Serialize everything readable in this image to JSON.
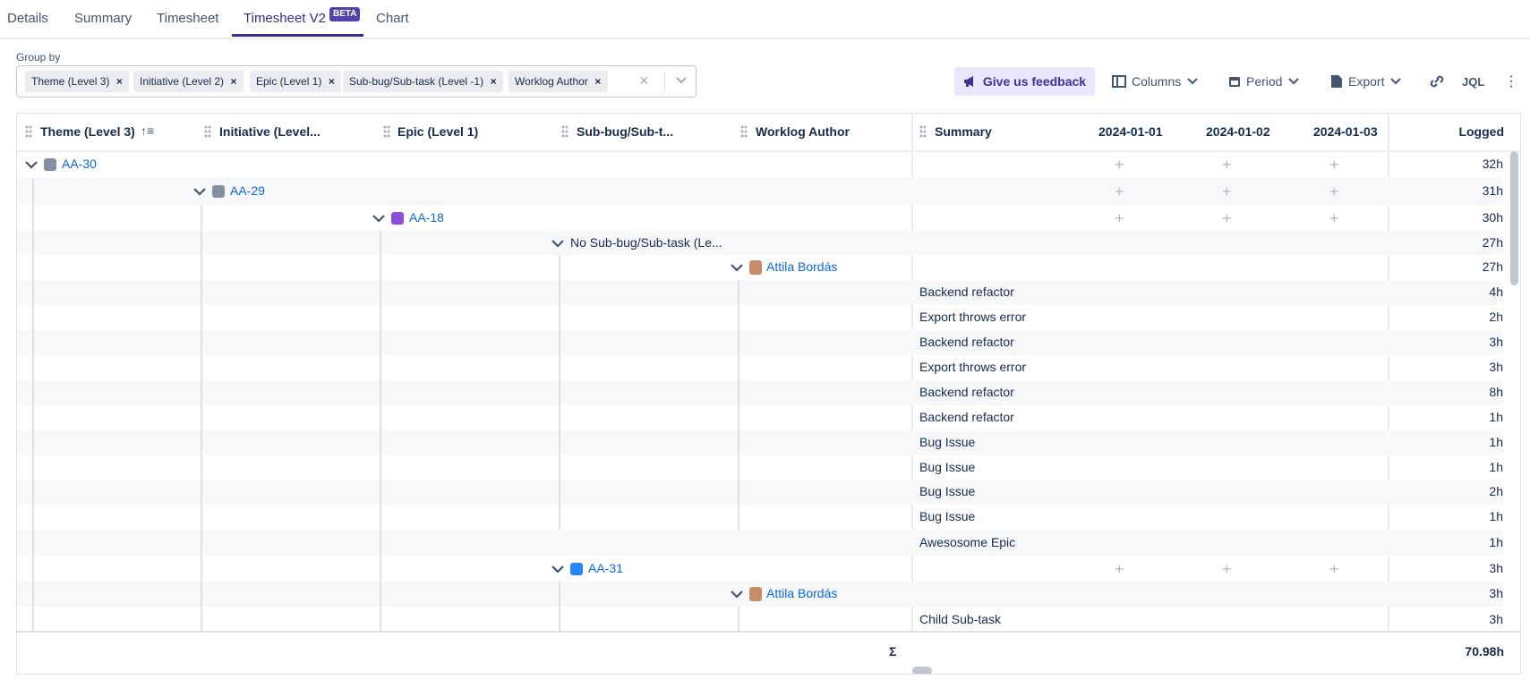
{
  "tabs": [
    {
      "label": "Details"
    },
    {
      "label": "Summary"
    },
    {
      "label": "Timesheet"
    },
    {
      "label": "Timesheet V2",
      "badge": "BETA"
    },
    {
      "label": "Chart"
    }
  ],
  "group_by": {
    "label": "Group by",
    "chips": [
      "Theme (Level 3)",
      "Initiative (Level 2)",
      "Epic (Level 1)",
      "Sub-bug/Sub-task (Level -1)",
      "Worklog Author"
    ]
  },
  "toolbar": {
    "feedback": "Give us feedback",
    "columns": "Columns",
    "period": "Period",
    "export": "Export",
    "jql": "JQL"
  },
  "columns": {
    "theme": "Theme (Level 3)",
    "initiative": "Initiative (Level...",
    "epic": "Epic (Level 1)",
    "subbug": "Sub-bug/Sub-t...",
    "author": "Worklog Author",
    "summary": "Summary",
    "d1": "2024-01-01",
    "d2": "2024-01-02",
    "d3": "2024-01-03",
    "logged": "Logged"
  },
  "rows": [
    {
      "level": 0,
      "key": "AA-30",
      "logged": "32h"
    },
    {
      "level": 1,
      "key": "AA-29",
      "logged": "31h"
    },
    {
      "level": 2,
      "key": "AA-18",
      "logged": "30h"
    },
    {
      "level": 3,
      "text": "No Sub-bug/Sub-task (Le...",
      "logged": "27h"
    },
    {
      "level": 4,
      "author": "Attila Bordás",
      "logged": "27h"
    },
    {
      "summary": "Backend refactor",
      "logged": "4h"
    },
    {
      "summary": "Export throws error",
      "logged": "2h"
    },
    {
      "summary": "Backend refactor",
      "logged": "3h"
    },
    {
      "summary": "Export throws error",
      "logged": "3h"
    },
    {
      "summary": "Backend refactor",
      "logged": "8h"
    },
    {
      "summary": "Backend refactor",
      "logged": "1h"
    },
    {
      "summary": "Bug Issue",
      "logged": "1h"
    },
    {
      "summary": "Bug Issue",
      "logged": "1h"
    },
    {
      "summary": "Bug Issue",
      "logged": "2h"
    },
    {
      "summary": "Bug Issue",
      "logged": "1h"
    },
    {
      "summary": "Awesosome Epic",
      "logged": "1h"
    },
    {
      "level": 3,
      "key": "AA-31",
      "logged": "3h"
    },
    {
      "level": 4,
      "author": "Attila Bordás",
      "logged": "3h"
    },
    {
      "summary": "Child Sub-task",
      "logged": "3h"
    }
  ],
  "footer": {
    "sigma": "Σ",
    "total": "70.98h"
  },
  "colors": {
    "accent": "#3b2d8f",
    "link": "#0c66e4",
    "badge": "#5243aa"
  }
}
